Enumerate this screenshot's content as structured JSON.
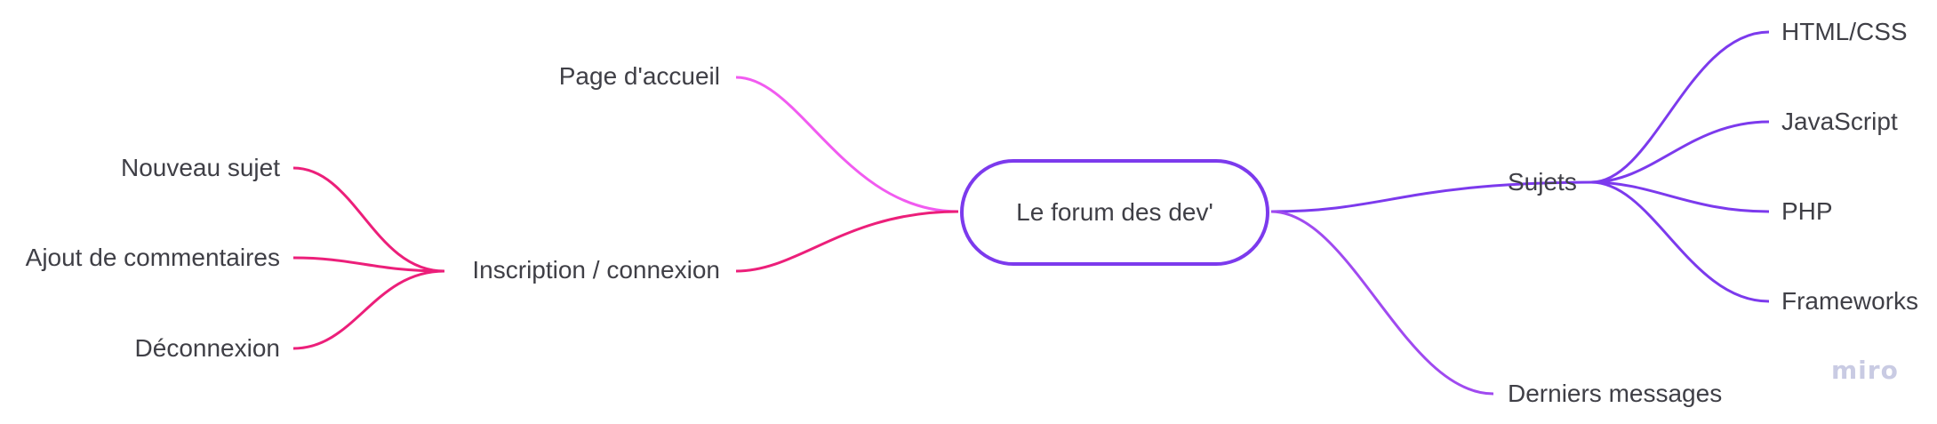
{
  "mindmap": {
    "center": {
      "label": "Le forum des dev'",
      "border_color": "#7c3aed"
    },
    "left": {
      "page_accueil": {
        "label": "Page d'accueil",
        "color": "#f15bf0"
      },
      "inscription": {
        "label": "Inscription / connexion",
        "color": "#ec1f7a",
        "children": [
          "Nouveau sujet",
          "Ajout de commentaires",
          "Déconnexion"
        ]
      }
    },
    "right": {
      "sujets": {
        "label": "Sujets",
        "color": "#7c3aed",
        "children": [
          "HTML/CSS",
          "JavaScript",
          "PHP",
          "Frameworks"
        ]
      },
      "derniers_messages": {
        "label": "Derniers messages",
        "color": "#a04af0"
      }
    }
  },
  "watermark": {
    "label": "miro",
    "color": "#c9cbe3"
  }
}
